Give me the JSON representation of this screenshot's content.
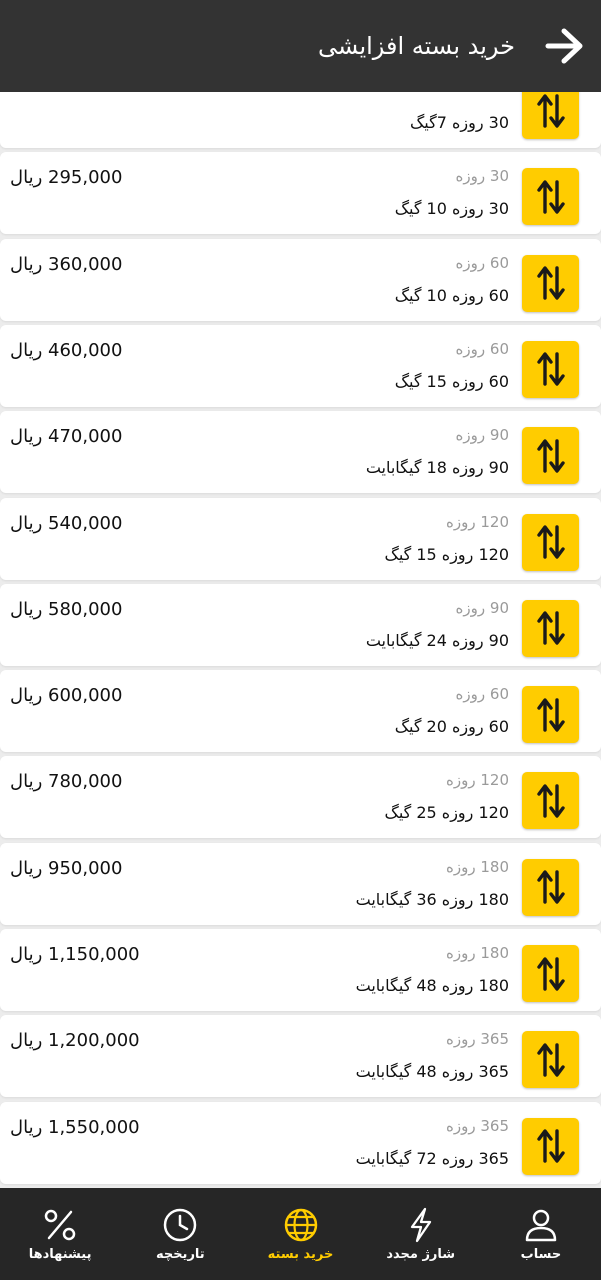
{
  "header": {
    "title": "خرید بسته افزایشی"
  },
  "packages": [
    {
      "sub": "",
      "name": "30 روزه 7گیگ",
      "price": ""
    },
    {
      "sub": "30 روزه",
      "name": "30 روزه 10 گیگ",
      "price": "295,000 ریال"
    },
    {
      "sub": "60 روزه",
      "name": "60 روزه 10 گیگ",
      "price": "360,000 ریال"
    },
    {
      "sub": "60 روزه",
      "name": "60 روزه 15 گیگ",
      "price": "460,000 ریال"
    },
    {
      "sub": "90 روزه",
      "name": "90 روزه 18 گیگابایت",
      "price": "470,000 ریال"
    },
    {
      "sub": "120 روزه",
      "name": "120 روزه 15 گیگ",
      "price": "540,000 ریال"
    },
    {
      "sub": "90 روزه",
      "name": "90 روزه 24 گیگابایت",
      "price": "580,000 ریال"
    },
    {
      "sub": "60 روزه",
      "name": "60 روزه 20 گیگ",
      "price": "600,000 ریال"
    },
    {
      "sub": "120 روزه",
      "name": "120 روزه 25 گیگ",
      "price": "780,000 ریال"
    },
    {
      "sub": "180 روزه",
      "name": "180 روزه 36 گیگابایت",
      "price": "950,000 ریال"
    },
    {
      "sub": "180 روزه",
      "name": "180 روزه 48 گیگابایت",
      "price": "1,150,000 ریال"
    },
    {
      "sub": "365 روزه",
      "name": "365 روزه 48 گیگابایت",
      "price": "1,200,000 ریال"
    },
    {
      "sub": "365 روزه",
      "name": "365 روزه 72 گیگابایت",
      "price": "1,550,000 ریال"
    }
  ],
  "bottom_nav": [
    {
      "label": "پیشنهادها",
      "icon": "percent-icon"
    },
    {
      "label": "تاریخچه",
      "icon": "clock-icon"
    },
    {
      "label": "خرید بسته",
      "icon": "globe-icon",
      "active": true
    },
    {
      "label": "شارژ مجدد",
      "icon": "lightning-icon"
    },
    {
      "label": "حساب",
      "icon": "user-icon"
    }
  ],
  "colors": {
    "accent": "#ffcc00",
    "appbar": "#333333",
    "bottombar": "#262626"
  }
}
